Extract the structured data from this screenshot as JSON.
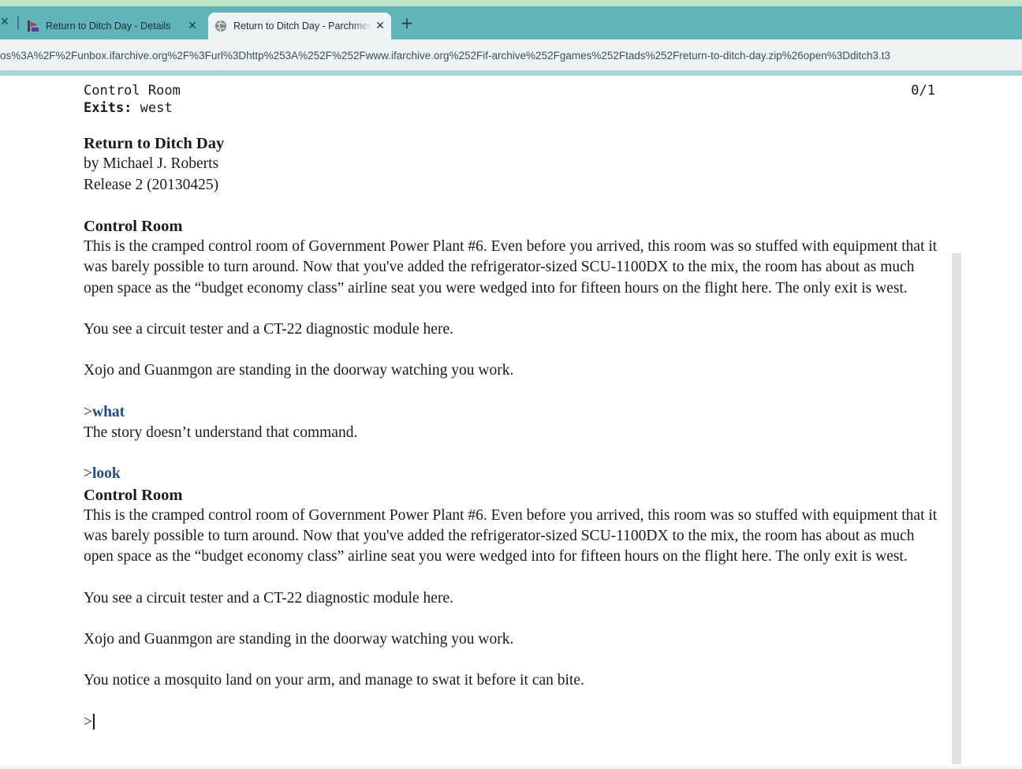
{
  "browser": {
    "tabs": [
      {
        "label": "Return to Ditch Day - Details",
        "icon": "ifdb-favicon"
      },
      {
        "label": "Return to Ditch Day - Parchment",
        "icon": "globe-icon"
      }
    ],
    "close_glyph": "✕",
    "new_tab_glyph": "+",
    "url": "os%3A%2F%2Funbox.ifarchive.org%2F%3Furl%3Dhttp%253A%252F%252Fwww.ifarchive.org%252Fif-archive%252Fgames%252Ftads%252Freturn-to-ditch-day.zip%26open%3Dditch3.t3"
  },
  "status": {
    "location": "Control Room",
    "score": "0/1",
    "exits_label": "Exits:",
    "exits_value": " west"
  },
  "transcript": {
    "game_title": "Return to Ditch Day",
    "author": "by Michael J. Roberts",
    "release": "Release 2 (20130425)",
    "room_name": "Control Room",
    "room_desc": "This is the cramped control room of Government Power Plant #6.  Even before you arrived, this room was so stuffed with equipment that it was barely possible to turn around.  Now that you've added the refrigerator-sized SCU-1100DX to the mix, the room has about as much open space as the “budget economy class” airline seat you were wedged into for fifteen hours on the flight here.  The only exit is west.",
    "objects": "You see a circuit tester and a CT-22 diagnostic module here.",
    "npcs": "Xojo and Guanmgon are standing in the doorway watching you work.",
    "prompt": ">",
    "cmd1": "what",
    "resp1": "The story doesn’t understand that command.",
    "cmd2": "look",
    "room_name_2": "Control Room",
    "room_desc_2": "This is the cramped control room of Government Power Plant #6.  Even before you arrived, this room was so stuffed with equipment that it was barely possible to turn around.  Now that you've added the refrigerator-sized SCU-1100DX to the mix, the room has about as much open space as the “budget economy class” airline seat you were wedged into for fifteen hours on the flight here.  The only exit is west.",
    "objects_2": "You see a circuit tester and a CT-22 diagnostic module here.",
    "npcs_2": "Xojo and Guanmgon are standing in the doorway watching you work.",
    "event": "You notice a mosquito land on your arm, and manage to swat it before it can bite.",
    "input_prompt": ">"
  }
}
